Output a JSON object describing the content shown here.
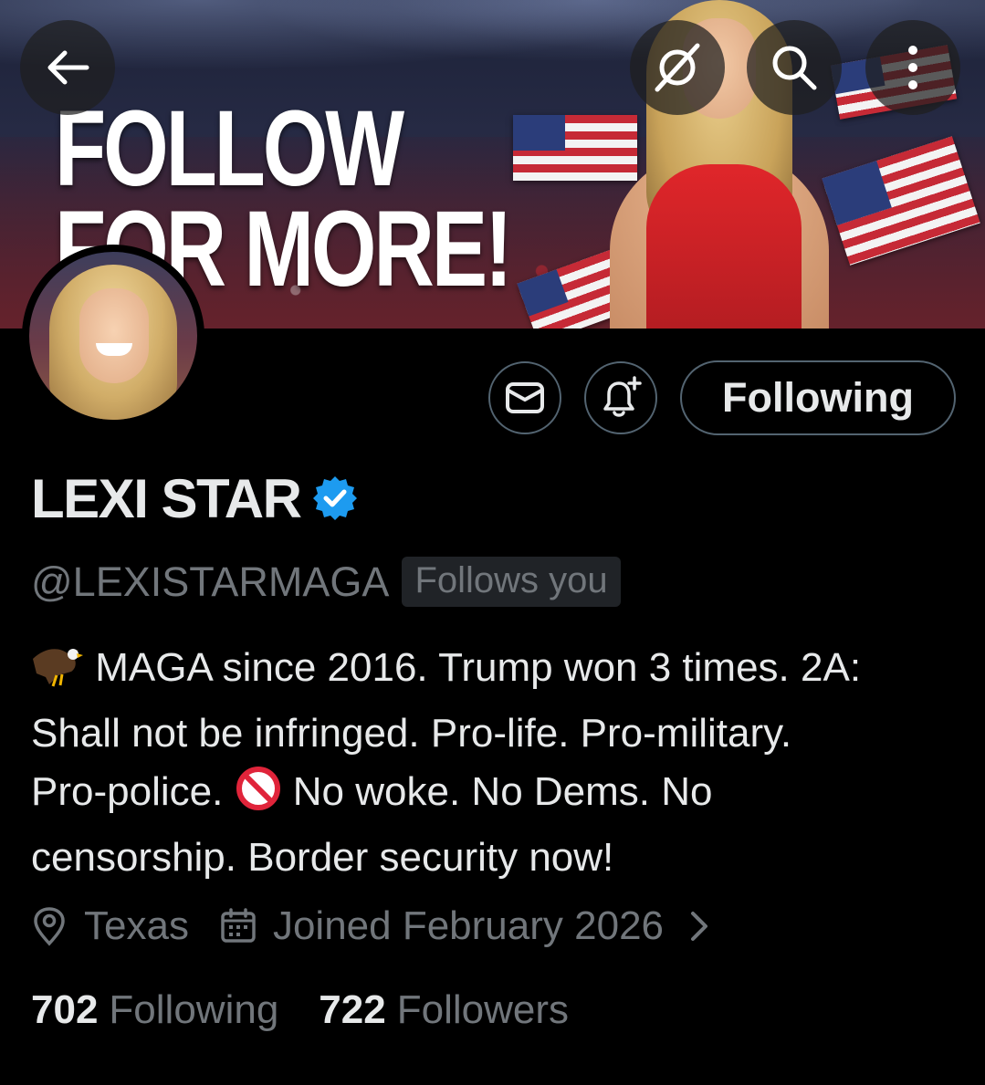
{
  "header": {
    "back_icon": "arrow-left-icon",
    "buttons": [
      "grok-icon",
      "search-icon",
      "more-vertical-icon"
    ]
  },
  "banner": {
    "headline_line1": "FOLLOW",
    "headline_line2": "FOR MORE!"
  },
  "actions": {
    "message_icon": "envelope-icon",
    "notify_icon": "bell-plus-icon",
    "follow_label": "Following"
  },
  "profile": {
    "display_name": "LEXI STAR",
    "verified_icon": "verified-badge-icon",
    "handle": "@LEXISTARMAGA",
    "follows_you": "Follows you",
    "bio_line1": "MAGA since 2016. Trump won 3 times. 2A:",
    "bio_line2": "Shall not be infringed. Pro-life. Pro-military.",
    "bio_line3a": "Pro-police.",
    "bio_line3b": "No woke. No Dems. No",
    "bio_line4": "censorship. Border security now!",
    "location": "Texas",
    "joined": "Joined February 2026"
  },
  "stats": {
    "following_count": "702",
    "following_label": "Following",
    "followers_count": "722",
    "followers_label": "Followers"
  },
  "colors": {
    "background": "#000000",
    "text": "#e7e9ea",
    "muted": "#71767b",
    "border": "#536471",
    "verified": "#1d9bf0"
  }
}
